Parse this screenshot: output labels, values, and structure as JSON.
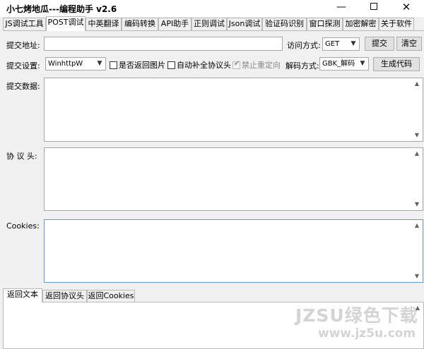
{
  "window": {
    "title": "小七烤地瓜---编程助手 v2.6",
    "minimize_label": "—",
    "close_label": "✕"
  },
  "tabs": [
    {
      "label": "JS调试工具"
    },
    {
      "label": "POST调试",
      "active": true
    },
    {
      "label": "中英翻译"
    },
    {
      "label": "编码转换"
    },
    {
      "label": "API助手"
    },
    {
      "label": "正则调试"
    },
    {
      "label": "Json调试"
    },
    {
      "label": "验证码识别"
    },
    {
      "label": "窗口探测"
    },
    {
      "label": "加密解密"
    },
    {
      "label": "关于软件"
    }
  ],
  "form": {
    "url_label": "提交地址:",
    "url_value": "",
    "method_label": "访问方式:",
    "method_value": "GET",
    "submit_button": "提交",
    "clear_button": "清空",
    "settings_label": "提交设置:",
    "engine_value": "WinhttpW",
    "return_image_label": "是否返回图片",
    "auto_header_label": "自动补全协议头",
    "no_redirect_label": "禁止重定向",
    "decode_label": "解码方式:",
    "decode_value": "GBK_解码",
    "generate_button": "生成代码",
    "data_label": "提交数据:",
    "header_label": "协 议 头:",
    "cookies_label": "Cookies:"
  },
  "result_tabs": [
    {
      "label": "返回文本",
      "active": true
    },
    {
      "label": "返回协议头"
    },
    {
      "label": "返回Cookies"
    }
  ],
  "watermark": {
    "text": "JZSU绿色下载",
    "url": "www.jz5u.com"
  },
  "icons": {
    "scroll_up": "scroll-up-arrow-icon",
    "scroll_down": "scroll-down-arrow-icon",
    "dropdown": "chevron-down-icon"
  }
}
